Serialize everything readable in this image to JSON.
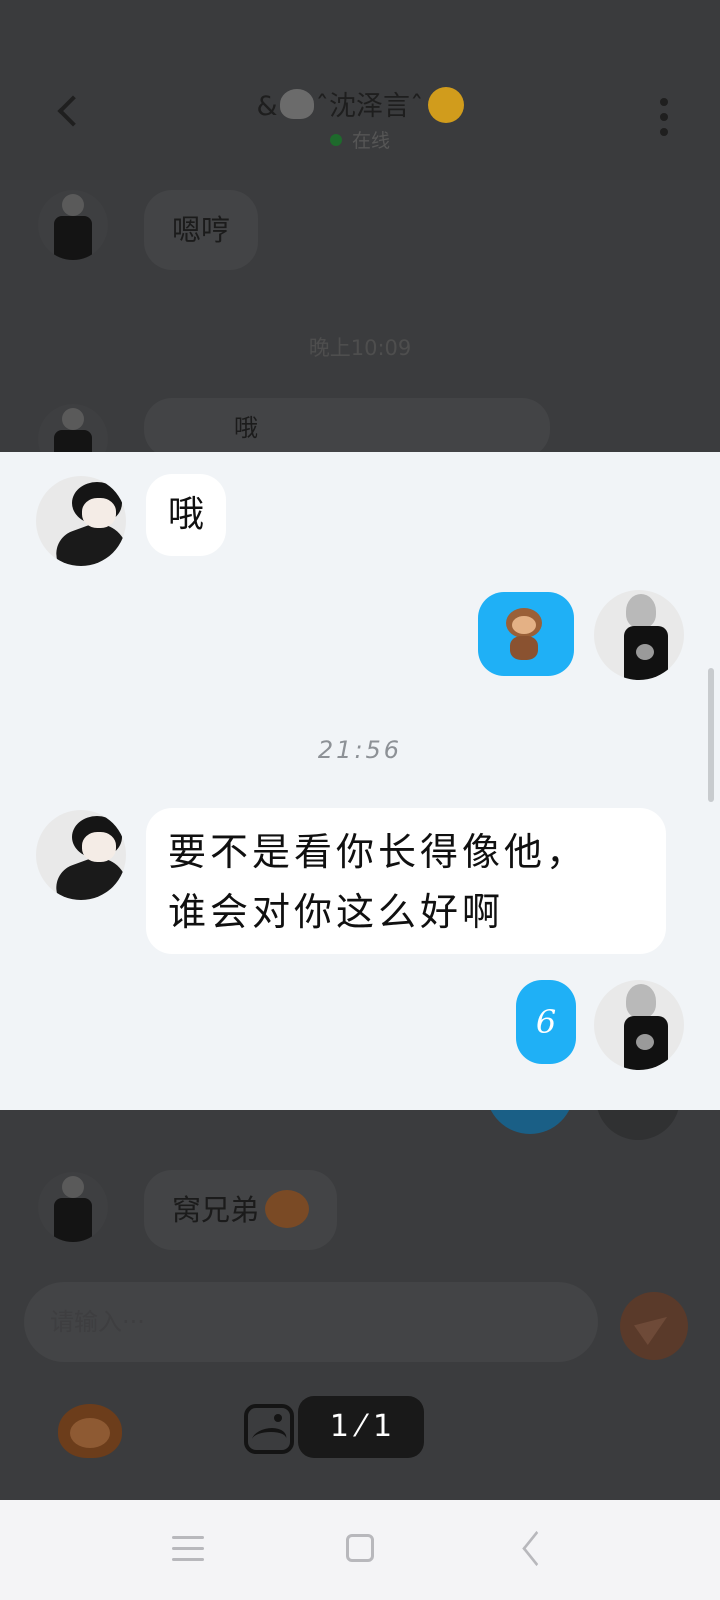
{
  "header": {
    "title_prefix": "&",
    "title_name": "ˆ沈泽言ˆ",
    "status": "在线"
  },
  "background_chat": {
    "msg_1": "嗯哼",
    "time_1": "晚上10:09",
    "msg_2": "哦",
    "msg_3": "窝兄弟"
  },
  "input": {
    "placeholder": "请输入···"
  },
  "snippet": {
    "msg_o": "哦",
    "time": "21:56",
    "msg_long_line1": "要不是看你长得像他，",
    "msg_long_line2": "谁会对你这么好啊",
    "msg_six": "6"
  },
  "page_indicator": "1 ⁄ 1",
  "icons": {
    "back": "chevron-left-icon",
    "more": "more-vertical-icon",
    "monkey": "monkey-emoji-icon",
    "sticker": "sticker-icon",
    "image": "image-icon",
    "send": "send-icon"
  },
  "colors": {
    "accent_blue": "#1fb0f6",
    "online_green": "#1e6a2c",
    "snippet_bg": "#f1f4f7"
  }
}
